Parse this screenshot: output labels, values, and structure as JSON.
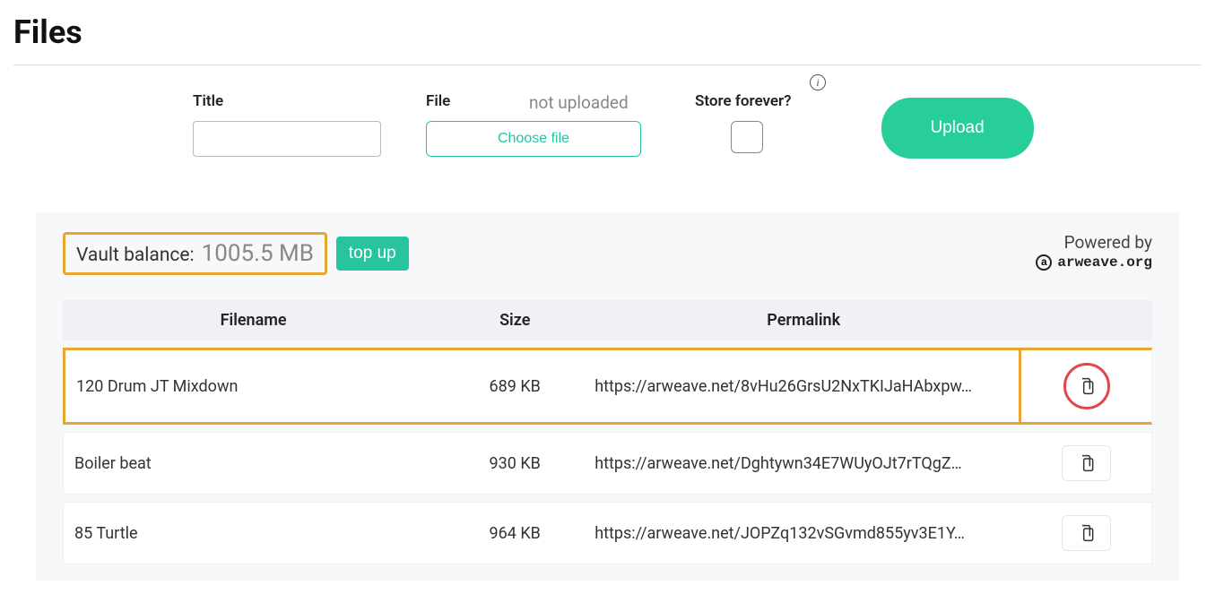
{
  "page": {
    "title": "Files"
  },
  "form": {
    "title_label": "Title",
    "file_label": "File",
    "file_status": "not uploaded",
    "choose_file_label": "Choose file",
    "store_label": "Store forever?",
    "upload_label": "Upload"
  },
  "balance": {
    "label": "Vault balance:",
    "value": "1005.5 MB",
    "topup_label": "top up"
  },
  "powered": {
    "label": "Powered by",
    "logo_glyph": "a",
    "name": "arweave.org"
  },
  "table": {
    "headers": {
      "filename": "Filename",
      "size": "Size",
      "permalink": "Permalink"
    },
    "rows": [
      {
        "filename": "120 Drum JT Mixdown",
        "size": "689 KB",
        "permalink": "https://arweave.net/8vHu26GrsU2NxTKIJaHAbxpw…",
        "highlighted": true
      },
      {
        "filename": "Boiler beat",
        "size": "930 KB",
        "permalink": "https://arweave.net/Dghtywn34E7WUyOJt7rTQgZ…",
        "highlighted": false
      },
      {
        "filename": "85 Turtle",
        "size": "964 KB",
        "permalink": "https://arweave.net/JOPZq132vSGvmd855yv3E1Y…",
        "highlighted": false
      }
    ]
  }
}
